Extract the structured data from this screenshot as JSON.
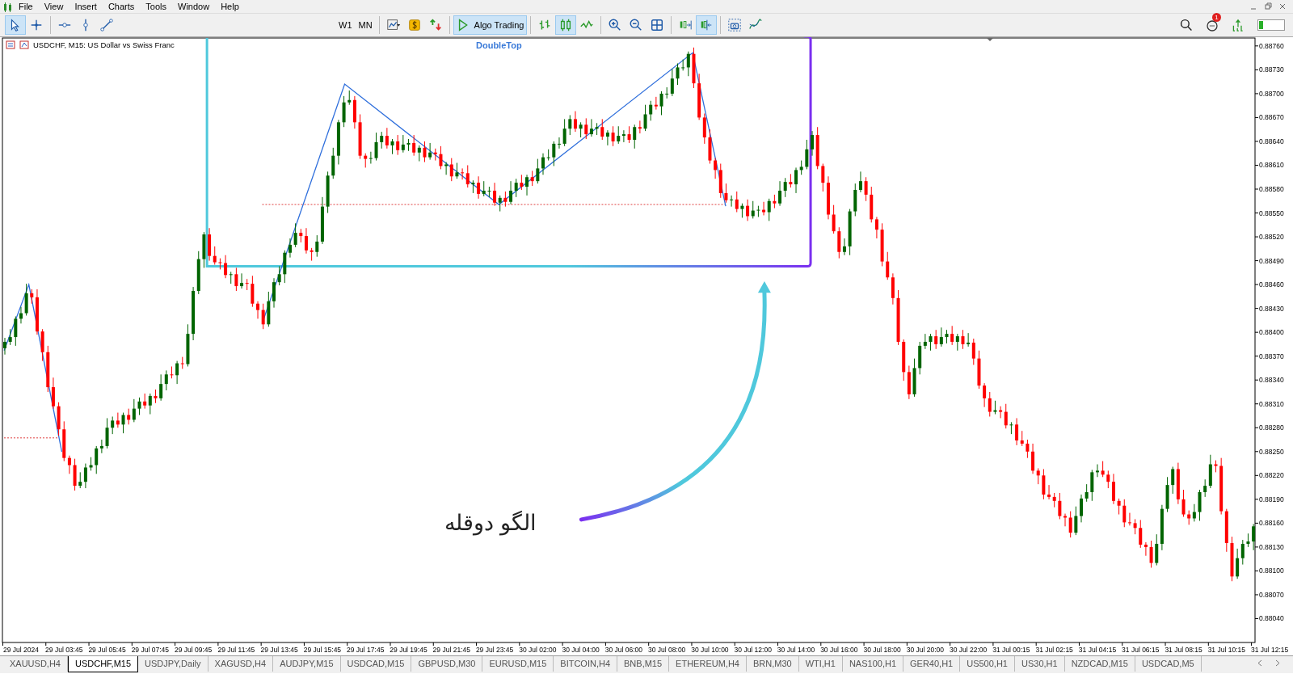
{
  "menu": [
    {
      "label": "File"
    },
    {
      "label": "View"
    },
    {
      "label": "Insert"
    },
    {
      "label": "Charts"
    },
    {
      "label": "Tools"
    },
    {
      "label": "Window"
    },
    {
      "label": "Help"
    }
  ],
  "toolbar": {
    "tools": [
      {
        "kind": "cursor",
        "selected": true
      },
      {
        "kind": "crosshair",
        "selected": false
      },
      {
        "kind": "sep"
      },
      {
        "kind": "hline",
        "selected": false
      },
      {
        "kind": "vline",
        "selected": false
      },
      {
        "kind": "trend",
        "selected": false
      },
      {
        "kind": "gap"
      },
      {
        "kind": "timeframe",
        "label": "W1",
        "selected": false
      },
      {
        "kind": "timeframe",
        "label": "MN",
        "selected": false
      },
      {
        "kind": "sep"
      },
      {
        "kind": "charttype",
        "selected": false
      },
      {
        "kind": "dollar",
        "selected": false
      },
      {
        "kind": "trade",
        "selected": false
      },
      {
        "kind": "sep"
      },
      {
        "kind": "algo",
        "label": "Algo Trading",
        "selected": true
      },
      {
        "kind": "sep"
      },
      {
        "kind": "bars",
        "selected": false
      },
      {
        "kind": "candles",
        "selected": true
      },
      {
        "kind": "line",
        "selected": false
      },
      {
        "kind": "sep"
      },
      {
        "kind": "zoomin",
        "selected": false
      },
      {
        "kind": "zoomout",
        "selected": false
      },
      {
        "kind": "grid",
        "selected": false
      },
      {
        "kind": "sep"
      },
      {
        "kind": "autoscroll",
        "selected": false
      },
      {
        "kind": "shift",
        "selected": true
      },
      {
        "kind": "sep"
      },
      {
        "kind": "screenshot",
        "selected": false
      },
      {
        "kind": "indicators",
        "selected": false
      }
    ],
    "notifications": "1"
  },
  "chart": {
    "title": "USDCHF, M15:  US Dollar vs Swiss Franc",
    "indicator": "DoubleTop",
    "annotation": "الگو دوقله",
    "chart_data": {
      "type": "candlestick",
      "ylim": [
        0.8801,
        0.8877
      ],
      "categories": [
        null,
        null,
        null,
        "29 Jul 2024",
        null,
        null,
        null,
        null,
        null,
        null,
        null,
        "29 Jul 03:45",
        null,
        null,
        null,
        null,
        null,
        null,
        null,
        "29 Jul 05:45",
        null,
        null,
        null,
        null,
        null,
        null,
        null,
        "29 Jul 07:45",
        null,
        null,
        null,
        null,
        null,
        null,
        null,
        "29 Jul 09:45",
        null,
        null,
        null,
        null,
        null,
        null,
        null,
        "29 Jul 11:45",
        null,
        null,
        null,
        null,
        null,
        null,
        null,
        "29 Jul 13:45",
        null,
        null,
        null,
        null,
        null,
        null,
        null,
        "29 Jul 15:45",
        null,
        null,
        null,
        null,
        null,
        null,
        null,
        "29 Jul 17:45",
        null,
        null,
        null,
        null,
        null,
        null,
        null,
        "29 Jul 19:45",
        null,
        null,
        null,
        null,
        null,
        null,
        null,
        "29 Jul 21:45",
        null,
        null,
        null,
        null,
        null,
        null,
        null,
        "29 Jul 23:45",
        null,
        null,
        null,
        null,
        null,
        null,
        null,
        "30 Jul 02:00",
        null,
        null,
        null,
        null,
        null,
        null,
        null,
        "30 Jul 04:00",
        null,
        null,
        null,
        null,
        null,
        null,
        null,
        "30 Jul 06:00",
        null,
        null,
        null,
        null,
        null,
        null,
        null,
        "30 Jul 08:00",
        null,
        null,
        null,
        null,
        null,
        null,
        null,
        "30 Jul 10:00",
        null,
        null,
        null,
        null,
        null,
        null,
        null,
        "30 Jul 12:00",
        null,
        null,
        null,
        null,
        null,
        null,
        null,
        "30 Jul 14:00",
        null,
        null,
        null,
        null,
        null,
        null,
        null,
        "30 Jul 16:00",
        null,
        null,
        null,
        null,
        null,
        null,
        null,
        "30 Jul 18:00",
        null,
        null,
        null,
        null,
        null,
        null,
        null,
        "30 Jul 20:00",
        null,
        null,
        null,
        null,
        null,
        null,
        null,
        "30 Jul 22:00",
        null,
        null,
        null,
        null,
        null,
        null,
        null,
        "31 Jul 00:15",
        null,
        null,
        null,
        null,
        null,
        null,
        null,
        "31 Jul 02:15",
        null,
        null,
        null,
        null,
        null,
        null,
        null,
        "31 Jul 04:15",
        null,
        null,
        null,
        null,
        null,
        null,
        null,
        "31 Jul 06:15",
        null,
        null,
        null,
        null,
        null,
        null,
        null,
        "31 Jul 08:15",
        null,
        null,
        null,
        null,
        null,
        null,
        null,
        "31 Jul 10:15",
        null,
        null,
        null,
        null,
        null,
        null,
        null,
        "31 Jul 12:15"
      ],
      "yticks": [
        {
          "value": 0.8876,
          "label": "0.88760"
        },
        {
          "value": 0.8873,
          "label": "0.88730"
        },
        {
          "value": 0.887,
          "label": "0.88700"
        },
        {
          "value": 0.8867,
          "label": "0.88670"
        },
        {
          "value": 0.8864,
          "label": "0.88640"
        },
        {
          "value": 0.8861,
          "label": "0.88610"
        },
        {
          "value": 0.8858,
          "label": "0.88580"
        },
        {
          "value": 0.8855,
          "label": "0.88550"
        },
        {
          "value": 0.8852,
          "label": "0.88520"
        },
        {
          "value": 0.8849,
          "label": "0.88490"
        },
        {
          "value": 0.8846,
          "label": "0.88460"
        },
        {
          "value": 0.8843,
          "label": "0.88430"
        },
        {
          "value": 0.884,
          "label": "0.88400"
        },
        {
          "value": 0.8837,
          "label": "0.88370"
        },
        {
          "value": 0.8834,
          "label": "0.88340"
        },
        {
          "value": 0.8831,
          "label": "0.88310"
        },
        {
          "value": 0.8828,
          "label": "0.88280"
        },
        {
          "value": 0.8825,
          "label": "0.88250"
        },
        {
          "value": 0.8822,
          "label": "0.88220"
        },
        {
          "value": 0.8819,
          "label": "0.88190"
        },
        {
          "value": 0.8816,
          "label": "0.88160"
        },
        {
          "value": 0.8813,
          "label": "0.88130"
        },
        {
          "value": 0.881,
          "label": "0.88100"
        },
        {
          "value": 0.8807,
          "label": "0.88070"
        },
        {
          "value": 0.8804,
          "label": "0.88040"
        }
      ],
      "ohlc": [
        [
          0.8838,
          0.88393,
          0.88372,
          0.88388
        ],
        [
          0.88388,
          0.88404,
          0.88384,
          0.88394
        ],
        [
          0.88394,
          0.8842,
          0.88383,
          0.88417
        ],
        [
          0.88417,
          0.88432,
          0.88411,
          0.88424
        ],
        [
          0.88424,
          0.88461,
          0.88421,
          0.88449
        ],
        [
          0.88449,
          0.88454,
          0.88436,
          0.88444
        ],
        [
          0.88444,
          0.88454,
          0.88397,
          0.88401
        ],
        [
          0.88401,
          0.88404,
          0.88364,
          0.88375
        ],
        [
          0.88375,
          0.88383,
          0.88325,
          0.88331
        ],
        [
          0.88331,
          0.88343,
          0.88304,
          0.88307
        ],
        [
          0.88307,
          0.88312,
          0.8827,
          0.88278
        ],
        [
          0.88278,
          0.88288,
          0.88238,
          0.88242
        ],
        [
          0.88242,
          0.88245,
          0.88222,
          0.88233
        ],
        [
          0.88233,
          0.88241,
          0.88201,
          0.88207
        ],
        [
          0.88207,
          0.88224,
          0.88204,
          0.88212
        ],
        [
          0.88212,
          0.88235,
          0.88204,
          0.8823
        ],
        [
          0.8823,
          0.88243,
          0.88226,
          0.88233
        ],
        [
          0.88233,
          0.88257,
          0.88222,
          0.88254
        ],
        [
          0.88254,
          0.88265,
          0.88248,
          0.88257
        ],
        [
          0.88257,
          0.88292,
          0.88254,
          0.8828
        ],
        [
          0.8828,
          0.88294,
          0.88272,
          0.88289
        ],
        [
          0.88289,
          0.88299,
          0.8828,
          0.88284
        ],
        [
          0.88284,
          0.88299,
          0.88273,
          0.88296
        ],
        [
          0.88296,
          0.88304,
          0.88284,
          0.8829
        ],
        [
          0.8829,
          0.88316,
          0.88287,
          0.88304
        ],
        [
          0.88304,
          0.88318,
          0.88296,
          0.88313
        ],
        [
          0.88313,
          0.88323,
          0.88304,
          0.88308
        ],
        [
          0.88308,
          0.88323,
          0.88297,
          0.8832
        ],
        [
          0.8832,
          0.88328,
          0.88311,
          0.88317
        ],
        [
          0.88317,
          0.88347,
          0.88314,
          0.88335
        ],
        [
          0.88335,
          0.88352,
          0.88327,
          0.88347
        ],
        [
          0.88347,
          0.88357,
          0.88342,
          0.88346
        ],
        [
          0.88346,
          0.88364,
          0.88335,
          0.88361
        ],
        [
          0.88361,
          0.88369,
          0.88354,
          0.8836
        ],
        [
          0.8836,
          0.8841,
          0.88357,
          0.88398
        ],
        [
          0.88398,
          0.88457,
          0.8839,
          0.88452
        ],
        [
          0.88452,
          0.88502,
          0.88448,
          0.88492
        ],
        [
          0.88492,
          0.88526,
          0.88481,
          0.88523
        ],
        [
          0.88523,
          0.88531,
          0.8849,
          0.88496
        ],
        [
          0.88496,
          0.88508,
          0.88485,
          0.88488
        ],
        [
          0.88488,
          0.88493,
          0.88479,
          0.88487
        ],
        [
          0.88487,
          0.88497,
          0.88468,
          0.88472
        ],
        [
          0.88472,
          0.88476,
          0.88461,
          0.88473
        ],
        [
          0.88473,
          0.88481,
          0.88452,
          0.88458
        ],
        [
          0.88458,
          0.88474,
          0.88455,
          0.88462
        ],
        [
          0.88462,
          0.88467,
          0.88453,
          0.88461
        ],
        [
          0.88461,
          0.88471,
          0.88432,
          0.88436
        ],
        [
          0.88436,
          0.88439,
          0.88417,
          0.88428
        ],
        [
          0.88428,
          0.88436,
          0.88404,
          0.8841
        ],
        [
          0.8841,
          0.88451,
          0.88407,
          0.88439
        ],
        [
          0.88439,
          0.88468,
          0.88431,
          0.88463
        ],
        [
          0.88463,
          0.88483,
          0.88459,
          0.88473
        ],
        [
          0.88473,
          0.88503,
          0.88462,
          0.885
        ],
        [
          0.885,
          0.88518,
          0.88494,
          0.8851
        ],
        [
          0.8851,
          0.88537,
          0.88507,
          0.88525
        ],
        [
          0.88525,
          0.8853,
          0.88513,
          0.88521
        ],
        [
          0.88521,
          0.88531,
          0.88499,
          0.88503
        ],
        [
          0.88503,
          0.88506,
          0.8849,
          0.88501
        ],
        [
          0.88501,
          0.88522,
          0.88495,
          0.88514
        ],
        [
          0.88514,
          0.8857,
          0.88511,
          0.88558
        ],
        [
          0.88558,
          0.88602,
          0.8855,
          0.88597
        ],
        [
          0.88597,
          0.88632,
          0.88593,
          0.88622
        ],
        [
          0.88622,
          0.88667,
          0.88611,
          0.88664
        ],
        [
          0.88664,
          0.88697,
          0.88658,
          0.88689
        ],
        [
          0.88689,
          0.88704,
          0.88686,
          0.88692
        ],
        [
          0.88692,
          0.88697,
          0.88656,
          0.88664
        ],
        [
          0.88664,
          0.88674,
          0.88618,
          0.88622
        ],
        [
          0.88622,
          0.88625,
          0.88607,
          0.88618
        ],
        [
          0.88618,
          0.88627,
          0.88612,
          0.88619
        ],
        [
          0.88619,
          0.88651,
          0.88616,
          0.88639
        ],
        [
          0.88639,
          0.88652,
          0.88631,
          0.88647
        ],
        [
          0.88647,
          0.88657,
          0.88631,
          0.88635
        ],
        [
          0.88635,
          0.88643,
          0.88624,
          0.8864
        ],
        [
          0.8864,
          0.88648,
          0.88623,
          0.88629
        ],
        [
          0.88629,
          0.88648,
          0.88626,
          0.88636
        ],
        [
          0.88636,
          0.88643,
          0.88628,
          0.88638
        ],
        [
          0.88638,
          0.88648,
          0.88622,
          0.88626
        ],
        [
          0.88626,
          0.88635,
          0.88615,
          0.88632
        ],
        [
          0.88632,
          0.8864,
          0.88614,
          0.8862
        ],
        [
          0.8862,
          0.88638,
          0.88617,
          0.88626
        ],
        [
          0.88626,
          0.88631,
          0.88616,
          0.88624
        ],
        [
          0.88624,
          0.88634,
          0.88605,
          0.88609
        ],
        [
          0.88609,
          0.88614,
          0.88598,
          0.88611
        ],
        [
          0.88611,
          0.88619,
          0.8859,
          0.88596
        ],
        [
          0.88596,
          0.88613,
          0.88593,
          0.88601
        ],
        [
          0.88601,
          0.88606,
          0.88592,
          0.886
        ],
        [
          0.886,
          0.8861,
          0.88582,
          0.88586
        ],
        [
          0.88586,
          0.88591,
          0.88575,
          0.88588
        ],
        [
          0.88588,
          0.88596,
          0.88568,
          0.88574
        ],
        [
          0.88574,
          0.8859,
          0.88571,
          0.88578
        ],
        [
          0.88578,
          0.88583,
          0.8857,
          0.88578
        ],
        [
          0.88578,
          0.88588,
          0.88559,
          0.88563
        ],
        [
          0.88563,
          0.88572,
          0.88552,
          0.88569
        ],
        [
          0.88569,
          0.88577,
          0.88558,
          0.88564
        ],
        [
          0.88564,
          0.8859,
          0.88561,
          0.88578
        ],
        [
          0.88578,
          0.88593,
          0.8857,
          0.88588
        ],
        [
          0.88588,
          0.88598,
          0.88579,
          0.88583
        ],
        [
          0.88583,
          0.88598,
          0.88572,
          0.88595
        ],
        [
          0.88595,
          0.88603,
          0.88584,
          0.8859
        ],
        [
          0.8859,
          0.88618,
          0.88587,
          0.88606
        ],
        [
          0.88606,
          0.88625,
          0.88598,
          0.8862
        ],
        [
          0.8862,
          0.8863,
          0.88616,
          0.8862
        ],
        [
          0.8862,
          0.8864,
          0.88609,
          0.88637
        ],
        [
          0.88637,
          0.88645,
          0.88631,
          0.88637
        ],
        [
          0.88637,
          0.88668,
          0.88634,
          0.88656
        ],
        [
          0.88656,
          0.88673,
          0.88648,
          0.88668
        ],
        [
          0.88668,
          0.88678,
          0.88652,
          0.88656
        ],
        [
          0.88656,
          0.88664,
          0.88645,
          0.88661
        ],
        [
          0.88661,
          0.88669,
          0.88643,
          0.88649
        ],
        [
          0.88649,
          0.88668,
          0.88646,
          0.88656
        ],
        [
          0.88656,
          0.88663,
          0.88648,
          0.88658
        ],
        [
          0.88658,
          0.88668,
          0.88642,
          0.88646
        ],
        [
          0.88646,
          0.88654,
          0.88635,
          0.88651
        ],
        [
          0.88651,
          0.88659,
          0.88634,
          0.8864
        ],
        [
          0.8864,
          0.88659,
          0.88637,
          0.88647
        ],
        [
          0.88647,
          0.88654,
          0.88639,
          0.88649
        ],
        [
          0.88649,
          0.88659,
          0.88638,
          0.88642
        ],
        [
          0.88642,
          0.88661,
          0.88631,
          0.88658
        ],
        [
          0.88658,
          0.88666,
          0.8865,
          0.88656
        ],
        [
          0.88656,
          0.88686,
          0.88653,
          0.88674
        ],
        [
          0.88674,
          0.88691,
          0.88666,
          0.88686
        ],
        [
          0.88686,
          0.88696,
          0.8868,
          0.88684
        ],
        [
          0.88684,
          0.88703,
          0.88673,
          0.887
        ],
        [
          0.887,
          0.88708,
          0.88694,
          0.887
        ],
        [
          0.887,
          0.88731,
          0.88697,
          0.88719
        ],
        [
          0.88719,
          0.88738,
          0.88711,
          0.88733
        ],
        [
          0.88733,
          0.88743,
          0.88729,
          0.88733
        ],
        [
          0.88733,
          0.88753,
          0.88722,
          0.8875
        ],
        [
          0.8875,
          0.88758,
          0.88707,
          0.88713
        ],
        [
          0.88713,
          0.88725,
          0.88667,
          0.8867
        ],
        [
          0.8867,
          0.88675,
          0.88637,
          0.88645
        ],
        [
          0.88645,
          0.88655,
          0.88612,
          0.88616
        ],
        [
          0.88616,
          0.88619,
          0.88593,
          0.88604
        ],
        [
          0.88604,
          0.88612,
          0.88569,
          0.88575
        ],
        [
          0.88575,
          0.88587,
          0.88563,
          0.88566
        ],
        [
          0.88566,
          0.88572,
          0.88558,
          0.88567
        ],
        [
          0.88567,
          0.88577,
          0.88551,
          0.88555
        ],
        [
          0.88555,
          0.88562,
          0.88544,
          0.88559
        ],
        [
          0.88559,
          0.88567,
          0.8854,
          0.88546
        ],
        [
          0.88546,
          0.88565,
          0.88543,
          0.88553
        ],
        [
          0.88553,
          0.88559,
          0.88545,
          0.88554
        ],
        [
          0.88554,
          0.88564,
          0.88547,
          0.88551
        ],
        [
          0.88551,
          0.88568,
          0.8854,
          0.88565
        ],
        [
          0.88565,
          0.88573,
          0.88556,
          0.88562
        ],
        [
          0.88562,
          0.8859,
          0.88559,
          0.88578
        ],
        [
          0.88578,
          0.88594,
          0.8857,
          0.88589
        ],
        [
          0.88589,
          0.88599,
          0.88582,
          0.88586
        ],
        [
          0.88586,
          0.88607,
          0.88575,
          0.88604
        ],
        [
          0.88604,
          0.88616,
          0.88598,
          0.88608
        ],
        [
          0.88608,
          0.88642,
          0.88605,
          0.8863
        ],
        [
          0.8863,
          0.88653,
          0.88622,
          0.88648
        ],
        [
          0.88648,
          0.88658,
          0.88605,
          0.88609
        ],
        [
          0.88609,
          0.88612,
          0.88577,
          0.88588
        ],
        [
          0.88588,
          0.88596,
          0.88542,
          0.88548
        ],
        [
          0.88548,
          0.8856,
          0.88524,
          0.88527
        ],
        [
          0.88527,
          0.88532,
          0.88493,
          0.88501
        ],
        [
          0.88501,
          0.88518,
          0.88497,
          0.88508
        ],
        [
          0.88508,
          0.88555,
          0.88497,
          0.88552
        ],
        [
          0.88552,
          0.88587,
          0.88546,
          0.88579
        ],
        [
          0.88579,
          0.88602,
          0.88576,
          0.8859
        ],
        [
          0.8859,
          0.88595,
          0.88565,
          0.88573
        ],
        [
          0.88573,
          0.88583,
          0.88538,
          0.88542
        ],
        [
          0.88542,
          0.88545,
          0.88518,
          0.88529
        ],
        [
          0.88529,
          0.88537,
          0.88483,
          0.88489
        ],
        [
          0.88489,
          0.88501,
          0.88466,
          0.88469
        ],
        [
          0.88469,
          0.88474,
          0.88435,
          0.88443
        ],
        [
          0.88443,
          0.88453,
          0.88384,
          0.88388
        ],
        [
          0.88388,
          0.88391,
          0.88339,
          0.8835
        ],
        [
          0.8835,
          0.88358,
          0.88316,
          0.88322
        ],
        [
          0.88322,
          0.88367,
          0.88319,
          0.88355
        ],
        [
          0.88355,
          0.88388,
          0.88347,
          0.88383
        ],
        [
          0.88383,
          0.88398,
          0.88379,
          0.88388
        ],
        [
          0.88388,
          0.88398,
          0.88377,
          0.88395
        ],
        [
          0.88395,
          0.88403,
          0.88379,
          0.88385
        ],
        [
          0.88385,
          0.88406,
          0.88382,
          0.88394
        ],
        [
          0.88394,
          0.88403,
          0.88386,
          0.88398
        ],
        [
          0.88398,
          0.88408,
          0.88384,
          0.88388
        ],
        [
          0.88388,
          0.88398,
          0.88377,
          0.88395
        ],
        [
          0.88395,
          0.88403,
          0.88379,
          0.88385
        ],
        [
          0.88385,
          0.88399,
          0.88382,
          0.88387
        ],
        [
          0.88387,
          0.88392,
          0.88359,
          0.88367
        ],
        [
          0.88367,
          0.88377,
          0.88329,
          0.88333
        ],
        [
          0.88333,
          0.88336,
          0.88306,
          0.88317
        ],
        [
          0.88317,
          0.88325,
          0.88294,
          0.883
        ],
        [
          0.883,
          0.88314,
          0.88297,
          0.88302
        ],
        [
          0.88302,
          0.88307,
          0.88292,
          0.883
        ],
        [
          0.883,
          0.8831,
          0.88279,
          0.88283
        ],
        [
          0.88283,
          0.88287,
          0.88272,
          0.88284
        ],
        [
          0.88284,
          0.88292,
          0.88258,
          0.88264
        ],
        [
          0.88264,
          0.88276,
          0.88257,
          0.8826
        ],
        [
          0.8826,
          0.88265,
          0.88242,
          0.8825
        ],
        [
          0.8825,
          0.8826,
          0.88222,
          0.88226
        ],
        [
          0.88226,
          0.88229,
          0.88209,
          0.8822
        ],
        [
          0.8822,
          0.88228,
          0.8819,
          0.88196
        ],
        [
          0.88196,
          0.88208,
          0.8819,
          0.88193
        ],
        [
          0.88193,
          0.88198,
          0.8818,
          0.88188
        ],
        [
          0.88188,
          0.88198,
          0.88165,
          0.88169
        ],
        [
          0.88169,
          0.88172,
          0.88156,
          0.88167
        ],
        [
          0.88167,
          0.88175,
          0.88142,
          0.88148
        ],
        [
          0.88148,
          0.88181,
          0.88145,
          0.88169
        ],
        [
          0.88169,
          0.88196,
          0.88161,
          0.88191
        ],
        [
          0.88191,
          0.88209,
          0.88187,
          0.88199
        ],
        [
          0.88199,
          0.88227,
          0.88188,
          0.88224
        ],
        [
          0.88224,
          0.88234,
          0.88218,
          0.88226
        ],
        [
          0.88226,
          0.88238,
          0.88218,
          0.88221
        ],
        [
          0.88221,
          0.88226,
          0.88204,
          0.88212
        ],
        [
          0.88212,
          0.88222,
          0.88184,
          0.88188
        ],
        [
          0.88188,
          0.88191,
          0.88171,
          0.88182
        ],
        [
          0.88182,
          0.8819,
          0.88155,
          0.88161
        ],
        [
          0.88161,
          0.88173,
          0.88157,
          0.8816
        ],
        [
          0.8816,
          0.88165,
          0.88146,
          0.88154
        ],
        [
          0.88154,
          0.88164,
          0.88129,
          0.88133
        ],
        [
          0.88133,
          0.88136,
          0.88119,
          0.8813
        ],
        [
          0.8813,
          0.88138,
          0.88104,
          0.8811
        ],
        [
          0.8811,
          0.88146,
          0.88107,
          0.88134
        ],
        [
          0.88134,
          0.88183,
          0.88126,
          0.88178
        ],
        [
          0.88178,
          0.88218,
          0.88174,
          0.88208
        ],
        [
          0.88208,
          0.88231,
          0.88197,
          0.88228
        ],
        [
          0.88228,
          0.88236,
          0.88184,
          0.8819
        ],
        [
          0.8819,
          0.88202,
          0.88168,
          0.88171
        ],
        [
          0.88171,
          0.88176,
          0.88158,
          0.88166
        ],
        [
          0.88166,
          0.88184,
          0.88162,
          0.88174
        ],
        [
          0.88174,
          0.88202,
          0.88163,
          0.88199
        ],
        [
          0.88199,
          0.88215,
          0.88193,
          0.88207
        ],
        [
          0.88207,
          0.88246,
          0.88204,
          0.88234
        ],
        [
          0.88234,
          0.88239,
          0.88224,
          0.88232
        ],
        [
          0.88232,
          0.88242,
          0.88171,
          0.88175
        ],
        [
          0.88175,
          0.88178,
          0.88124,
          0.88135
        ],
        [
          0.88135,
          0.88143,
          0.88087,
          0.88093
        ],
        [
          0.88093,
          0.88128,
          0.8809,
          0.88116
        ],
        [
          0.88116,
          0.88139,
          0.88108,
          0.88134
        ],
        [
          0.88134,
          0.88147,
          0.8813,
          0.88137
        ],
        [
          0.88137,
          0.88159,
          0.88126,
          0.88156
        ],
        null,
        null,
        null
      ]
    }
  },
  "symbol_tabs": [
    {
      "label": "XAUUSD,H4",
      "selected": false
    },
    {
      "label": "USDCHF,M15",
      "selected": true
    },
    {
      "label": "USDJPY,Daily",
      "selected": false
    },
    {
      "label": "XAGUSD,H4",
      "selected": false
    },
    {
      "label": "AUDJPY,M15",
      "selected": false
    },
    {
      "label": "USDCAD,M15",
      "selected": false
    },
    {
      "label": "GBPUSD,M30",
      "selected": false
    },
    {
      "label": "EURUSD,M15",
      "selected": false
    },
    {
      "label": "BITCOIN,H4",
      "selected": false
    },
    {
      "label": "BNB,M15",
      "selected": false
    },
    {
      "label": "ETHEREUM,H4",
      "selected": false
    },
    {
      "label": "BRN,M30",
      "selected": false
    },
    {
      "label": "WTI,H1",
      "selected": false
    },
    {
      "label": "NAS100,H1",
      "selected": false
    },
    {
      "label": "GER40,H1",
      "selected": false
    },
    {
      "label": "US500,H1",
      "selected": false
    },
    {
      "label": "US30,H1",
      "selected": false
    },
    {
      "label": "NZDCAD,M15",
      "selected": false
    },
    {
      "label": "USDCAD,M5",
      "selected": false
    }
  ]
}
